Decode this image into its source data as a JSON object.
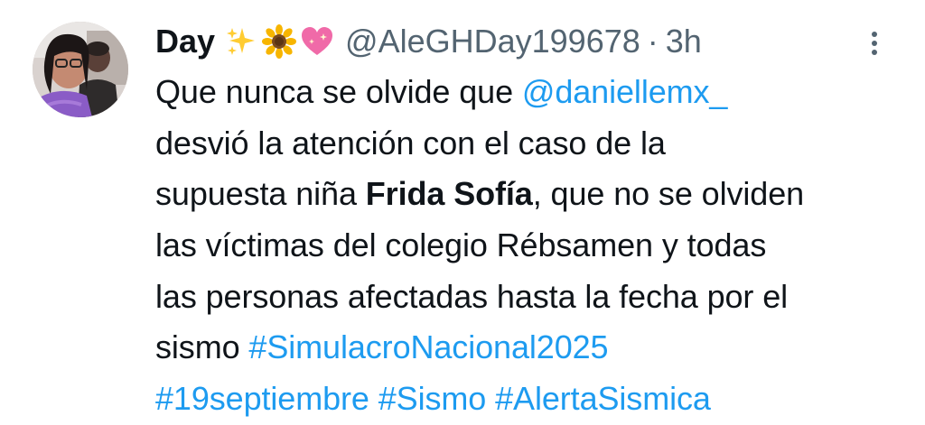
{
  "tweet": {
    "author": {
      "display_name": "Day",
      "emojis": [
        "sparkles",
        "sunflower",
        "sparkling-heart"
      ],
      "handle": "@AleGHDay199678",
      "separator": "·",
      "time": "3h"
    },
    "more_icon": "more-vertical-icon",
    "body": {
      "l1_text": "Que nunca se olvide que ",
      "l1_mention": "@daniellemx_",
      "l2_text": "desvió la atención con el caso de la",
      "l3_text_a": "supuesta niña ",
      "l3_bold": "Frida Sofía",
      "l3_text_b": ", que no se olviden",
      "l4_text": "las víctimas del colegio Rébsamen y todas",
      "l5_text": "las personas afectadas hasta la fecha por el",
      "l6_text": "sismo ",
      "l6_hashtag": "#SimulacroNacional2025",
      "l7_hashtag_1": "#19septiembre",
      "l7_hashtag_2": "#Sismo",
      "l7_hashtag_3": "#AlertaSismica"
    },
    "colors": {
      "text": "#0f1419",
      "secondary": "#536471",
      "link": "#1d9bf0"
    }
  }
}
